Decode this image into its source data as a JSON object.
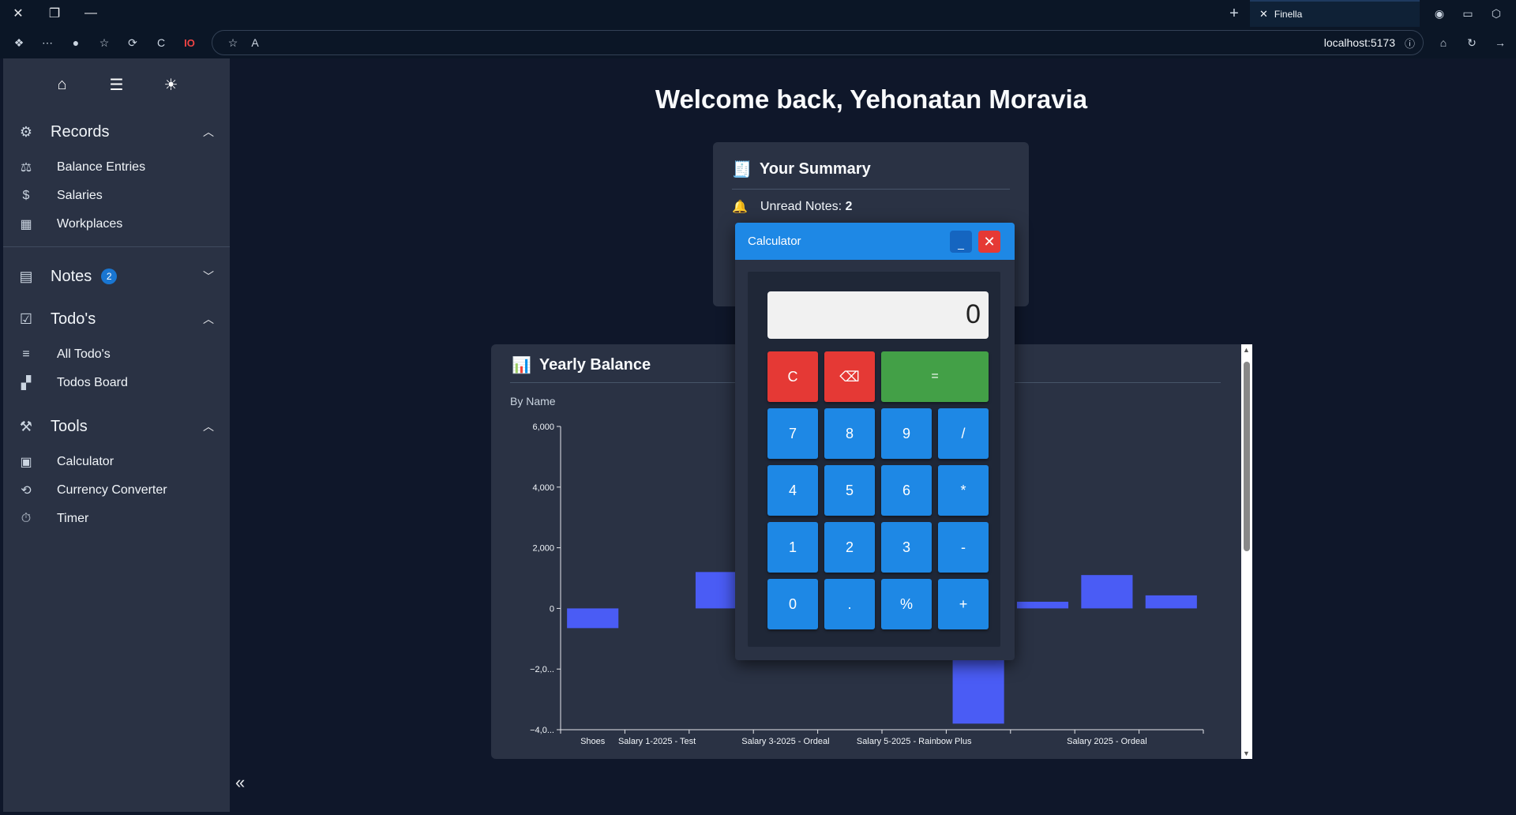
{
  "browser": {
    "tab_title": "Finella",
    "url": "localhost:5173"
  },
  "sidebar": {
    "sections": {
      "records": {
        "label": "Records",
        "items": [
          "Balance Entries",
          "Salaries",
          "Workplaces"
        ]
      },
      "notes": {
        "label": "Notes",
        "badge": "2"
      },
      "todos": {
        "label": "Todo's",
        "items": [
          "All Todo's",
          "Todos Board"
        ]
      },
      "tools": {
        "label": "Tools",
        "items": [
          "Calculator",
          "Currency Converter",
          "Timer"
        ]
      }
    }
  },
  "main": {
    "welcome": "Welcome back, Yehonatan Moravia",
    "summary": {
      "title": "Your Summary",
      "unread_label": "Unread Notes:",
      "unread_value": "2"
    },
    "yearly": {
      "title": "Yearly Balance",
      "subtitle": "By Name"
    }
  },
  "calculator": {
    "title": "Calculator",
    "display": "0",
    "keys": [
      "C",
      "⌫",
      "=",
      "7",
      "8",
      "9",
      "/",
      "4",
      "5",
      "6",
      "*",
      "1",
      "2",
      "3",
      "-",
      "0",
      ".",
      "%",
      "+"
    ]
  },
  "colors": {
    "accent": "#1e88e5",
    "bar": "#4a5cf5",
    "danger": "#e53935",
    "success": "#43a047"
  },
  "chart_data": {
    "type": "bar",
    "subtitle": "By Name",
    "ylim": [
      -4000,
      6000
    ],
    "yticks": [
      "6,000",
      "4,000",
      "2,000",
      "0",
      "−2,0...",
      "−4,0..."
    ],
    "ytick_values": [
      6000,
      4000,
      2000,
      0,
      -2000,
      -4000
    ],
    "xtick_labels": [
      "Shoes",
      "Salary 1-2025 - Test",
      "Salary 3-2025 - Ordeal",
      "Salary 5-2025 - Rainbow Plus",
      "Salary 2025 - Ordeal"
    ],
    "values": [
      -650,
      null,
      1200,
      null,
      null,
      null,
      -3800,
      220,
      1100,
      430
    ]
  }
}
